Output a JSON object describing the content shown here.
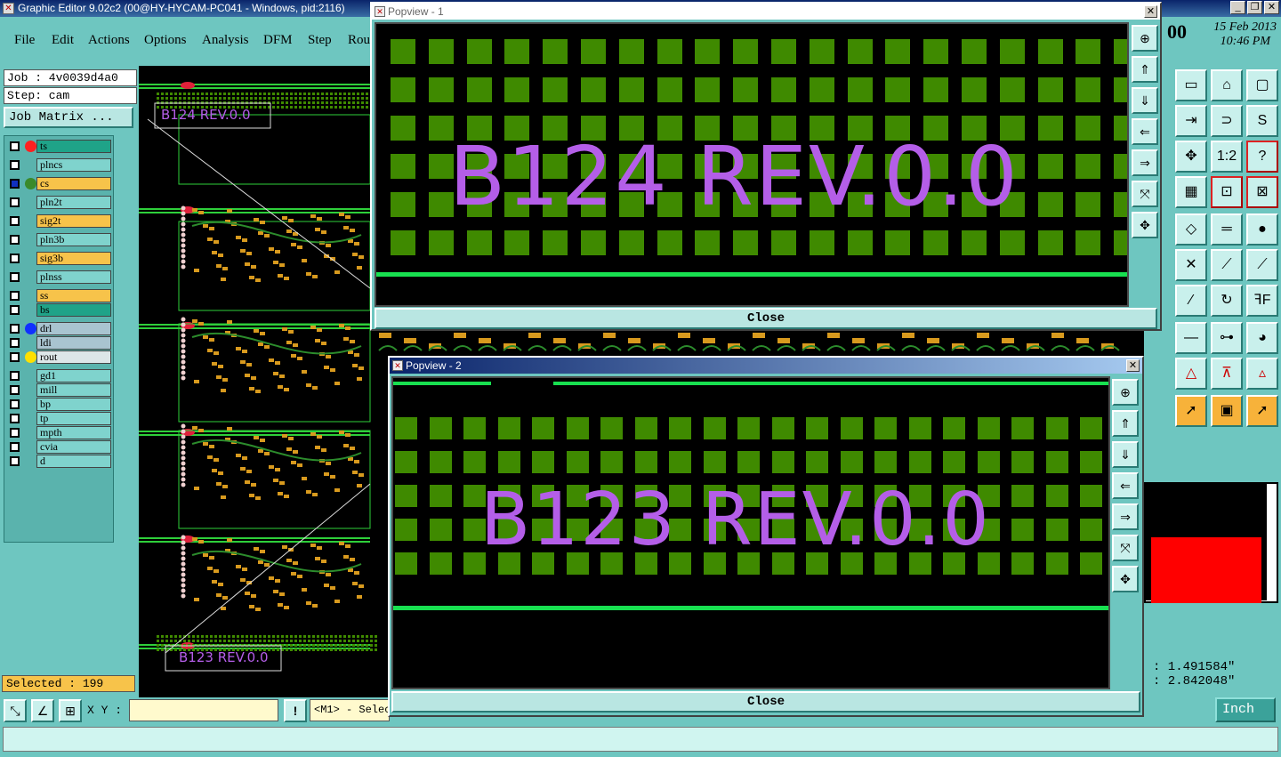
{
  "window": {
    "title": "Graphic Editor 9.02c2 (00@HY-HYCAM-PC041 - Windows, pid:2116)",
    "minimize": "_",
    "restore": "❐",
    "close": "✕"
  },
  "menu": [
    "File",
    "Edit",
    "Actions",
    "Options",
    "Analysis",
    "DFM",
    "Step",
    "Rou"
  ],
  "clock": {
    "prefix": "00",
    "date": "15 Feb 2013",
    "time": "10:46 PM"
  },
  "job": {
    "job_line": "Job : 4v0039d4a0",
    "step_line": "Step: cam",
    "matrix_button": "Job Matrix ..."
  },
  "layers": [
    {
      "name": "ts",
      "bg": "#1fa388",
      "dot": "#ff2020"
    },
    {
      "name": "plncs",
      "bg": "#7fd3cd",
      "dot": ""
    },
    {
      "name": "cs",
      "bg": "#f7c34a",
      "dot": "#3a8a2a",
      "active": true
    },
    {
      "name": "pln2t",
      "bg": "#7fd3cd",
      "dot": ""
    },
    {
      "name": "sig2t",
      "bg": "#f7c34a",
      "dot": ""
    },
    {
      "name": "pln3b",
      "bg": "#7fd3cd",
      "dot": ""
    },
    {
      "name": "sig3b",
      "bg": "#f7c34a",
      "dot": ""
    },
    {
      "name": "plnss",
      "bg": "#7fd3cd",
      "dot": ""
    },
    {
      "name": "ss",
      "bg": "#f7c34a",
      "dot": ""
    },
    {
      "name": "bs",
      "bg": "#1fa388",
      "dot": ""
    },
    {
      "name": "drl",
      "bg": "#a9c4d0",
      "dot": "#1030ff"
    },
    {
      "name": "ldi",
      "bg": "#a9c4d0",
      "dot": ""
    },
    {
      "name": "rout",
      "bg": "#dde6e8",
      "dot": "#ffe000"
    },
    {
      "name": "gd1",
      "bg": "#7fd3cd",
      "dot": ""
    },
    {
      "name": "mill",
      "bg": "#7fd3cd",
      "dot": ""
    },
    {
      "name": "bp",
      "bg": "#7fd3cd",
      "dot": ""
    },
    {
      "name": "tp",
      "bg": "#7fd3cd",
      "dot": ""
    },
    {
      "name": "mpth",
      "bg": "#7fd3cd",
      "dot": ""
    },
    {
      "name": "cvia",
      "bg": "#7fd3cd",
      "dot": ""
    },
    {
      "name": "d",
      "bg": "#7fd3cd",
      "dot": ""
    }
  ],
  "selected": "Selected : 199",
  "canvas": {
    "label_top": "B124 REV.0.0",
    "label_bottom": "B123 REV.0.0"
  },
  "popview1": {
    "title": "Popview - 1",
    "text": "B124 REV.0.0",
    "close": "Close"
  },
  "popview2": {
    "title": "Popview - 2",
    "text": "B123 REV.0.0",
    "close": "Close"
  },
  "coords": {
    "x": ": 1.491584\"",
    "y": ": 2.842048\""
  },
  "bottom": {
    "xy_label": "X Y :",
    "xy_value": "",
    "hint": "<M1> - Selec",
    "warn": "!",
    "unit": "Inch"
  },
  "colors": {
    "accent": "#6ec6c0",
    "pcb_green": "#3f8a00",
    "text_purple": "#b45ee8",
    "trace": "#18e050"
  }
}
